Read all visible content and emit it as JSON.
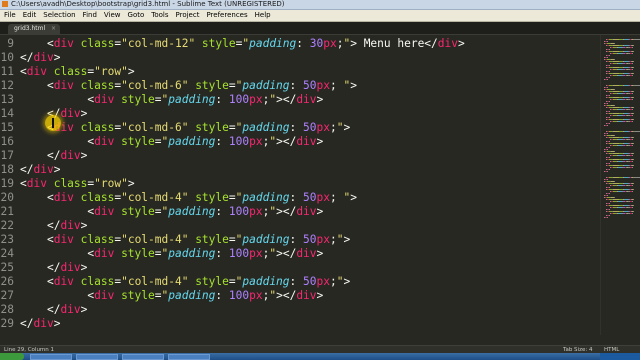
{
  "window": {
    "title": "C:\\Users\\avadh\\Desktop\\bootstrap\\grid3.html - Sublime Text (UNREGISTERED)"
  },
  "menu": [
    "File",
    "Edit",
    "Selection",
    "Find",
    "View",
    "Goto",
    "Tools",
    "Project",
    "Preferences",
    "Help"
  ],
  "tab": {
    "label": "grid3.html",
    "close_glyph": "×"
  },
  "status": {
    "position": "Line 29, Column 1",
    "tab_size": "Tab Size: 4",
    "syntax": "HTML"
  },
  "code": {
    "line_numbers": [
      "9",
      "10",
      "11",
      "12",
      "13",
      "14",
      "15",
      "16",
      "17",
      "18",
      "19",
      "20",
      "21",
      "22",
      "23",
      "24",
      "25",
      "26",
      "27",
      "28",
      "29"
    ],
    "lines": [
      [
        {
          "t": "    ",
          "c": "pn"
        },
        {
          "t": "<",
          "c": "pn"
        },
        {
          "t": "div",
          "c": "tg"
        },
        {
          "t": " class",
          "c": "at"
        },
        {
          "t": "=",
          "c": "pn"
        },
        {
          "t": "\"col-md-12\"",
          "c": "st"
        },
        {
          "t": " style",
          "c": "at"
        },
        {
          "t": "=",
          "c": "pn"
        },
        {
          "t": "\"",
          "c": "st"
        },
        {
          "t": "padding",
          "c": "cp"
        },
        {
          "t": ": ",
          "c": "pn"
        },
        {
          "t": "30",
          "c": "cv"
        },
        {
          "t": "px",
          "c": "cu"
        },
        {
          "t": ";",
          "c": "pn"
        },
        {
          "t": "\"",
          "c": "st"
        },
        {
          "t": "> Menu here</",
          "c": "pn"
        },
        {
          "t": "div",
          "c": "tg"
        },
        {
          "t": ">",
          "c": "pn"
        }
      ],
      [
        {
          "t": "</",
          "c": "pn"
        },
        {
          "t": "div",
          "c": "tg"
        },
        {
          "t": ">",
          "c": "pn"
        }
      ],
      [
        {
          "t": "<",
          "c": "pn"
        },
        {
          "t": "div",
          "c": "tg"
        },
        {
          "t": " class",
          "c": "at"
        },
        {
          "t": "=",
          "c": "pn"
        },
        {
          "t": "\"row\"",
          "c": "st"
        },
        {
          "t": ">",
          "c": "pn"
        }
      ],
      [
        {
          "t": "    ",
          "c": "pn"
        },
        {
          "t": "<",
          "c": "pn"
        },
        {
          "t": "div",
          "c": "tg"
        },
        {
          "t": " class",
          "c": "at"
        },
        {
          "t": "=",
          "c": "pn"
        },
        {
          "t": "\"col-md-6\"",
          "c": "st"
        },
        {
          "t": " style",
          "c": "at"
        },
        {
          "t": "=",
          "c": "pn"
        },
        {
          "t": "\"",
          "c": "st"
        },
        {
          "t": "padding",
          "c": "cp"
        },
        {
          "t": ": ",
          "c": "pn"
        },
        {
          "t": "50",
          "c": "cv"
        },
        {
          "t": "px",
          "c": "cu"
        },
        {
          "t": "; ",
          "c": "pn"
        },
        {
          "t": "\"",
          "c": "st"
        },
        {
          "t": ">",
          "c": "pn"
        }
      ],
      [
        {
          "t": "          ",
          "c": "pn"
        },
        {
          "t": "<",
          "c": "pn"
        },
        {
          "t": "div",
          "c": "tg"
        },
        {
          "t": " style",
          "c": "at"
        },
        {
          "t": "=",
          "c": "pn"
        },
        {
          "t": "\"",
          "c": "st"
        },
        {
          "t": "padding",
          "c": "cp"
        },
        {
          "t": ": ",
          "c": "pn"
        },
        {
          "t": "100",
          "c": "cv"
        },
        {
          "t": "px",
          "c": "cu"
        },
        {
          "t": ";",
          "c": "pn"
        },
        {
          "t": "\"",
          "c": "st"
        },
        {
          "t": "></",
          "c": "pn"
        },
        {
          "t": "div",
          "c": "tg"
        },
        {
          "t": ">",
          "c": "pn"
        }
      ],
      [
        {
          "t": "    ",
          "c": "pn"
        },
        {
          "t": "</",
          "c": "pn"
        },
        {
          "t": "div",
          "c": "tg"
        },
        {
          "t": ">",
          "c": "pn"
        }
      ],
      [
        {
          "t": "    ",
          "c": "pn"
        },
        {
          "t": "<",
          "c": "pn"
        },
        {
          "t": "div",
          "c": "tg"
        },
        {
          "t": " class",
          "c": "at"
        },
        {
          "t": "=",
          "c": "pn"
        },
        {
          "t": "\"col-md-6\"",
          "c": "st"
        },
        {
          "t": " style",
          "c": "at"
        },
        {
          "t": "=",
          "c": "pn"
        },
        {
          "t": "\"",
          "c": "st"
        },
        {
          "t": "padding",
          "c": "cp"
        },
        {
          "t": ": ",
          "c": "pn"
        },
        {
          "t": "50",
          "c": "cv"
        },
        {
          "t": "px",
          "c": "cu"
        },
        {
          "t": ";",
          "c": "pn"
        },
        {
          "t": "\"",
          "c": "st"
        },
        {
          "t": ">",
          "c": "pn"
        }
      ],
      [
        {
          "t": "          ",
          "c": "pn"
        },
        {
          "t": "<",
          "c": "pn"
        },
        {
          "t": "div",
          "c": "tg"
        },
        {
          "t": " style",
          "c": "at"
        },
        {
          "t": "=",
          "c": "pn"
        },
        {
          "t": "\"",
          "c": "st"
        },
        {
          "t": "padding",
          "c": "cp"
        },
        {
          "t": ": ",
          "c": "pn"
        },
        {
          "t": "100",
          "c": "cv"
        },
        {
          "t": "px",
          "c": "cu"
        },
        {
          "t": ";",
          "c": "pn"
        },
        {
          "t": "\"",
          "c": "st"
        },
        {
          "t": "></",
          "c": "pn"
        },
        {
          "t": "div",
          "c": "tg"
        },
        {
          "t": ">",
          "c": "pn"
        }
      ],
      [
        {
          "t": "    ",
          "c": "pn"
        },
        {
          "t": "</",
          "c": "pn"
        },
        {
          "t": "div",
          "c": "tg"
        },
        {
          "t": ">",
          "c": "pn"
        }
      ],
      [
        {
          "t": "</",
          "c": "pn"
        },
        {
          "t": "div",
          "c": "tg"
        },
        {
          "t": ">",
          "c": "pn"
        }
      ],
      [
        {
          "t": "<",
          "c": "pn"
        },
        {
          "t": "div",
          "c": "tg"
        },
        {
          "t": " class",
          "c": "at"
        },
        {
          "t": "=",
          "c": "pn"
        },
        {
          "t": "\"row\"",
          "c": "st"
        },
        {
          "t": ">",
          "c": "pn"
        }
      ],
      [
        {
          "t": "    ",
          "c": "pn"
        },
        {
          "t": "<",
          "c": "pn"
        },
        {
          "t": "div",
          "c": "tg"
        },
        {
          "t": " class",
          "c": "at"
        },
        {
          "t": "=",
          "c": "pn"
        },
        {
          "t": "\"col-md-4\"",
          "c": "st"
        },
        {
          "t": " style",
          "c": "at"
        },
        {
          "t": "=",
          "c": "pn"
        },
        {
          "t": "\"",
          "c": "st"
        },
        {
          "t": "padding",
          "c": "cp"
        },
        {
          "t": ": ",
          "c": "pn"
        },
        {
          "t": "50",
          "c": "cv"
        },
        {
          "t": "px",
          "c": "cu"
        },
        {
          "t": "; ",
          "c": "pn"
        },
        {
          "t": "\"",
          "c": "st"
        },
        {
          "t": ">",
          "c": "pn"
        }
      ],
      [
        {
          "t": "          ",
          "c": "pn"
        },
        {
          "t": "<",
          "c": "pn"
        },
        {
          "t": "div",
          "c": "tg"
        },
        {
          "t": " style",
          "c": "at"
        },
        {
          "t": "=",
          "c": "pn"
        },
        {
          "t": "\"",
          "c": "st"
        },
        {
          "t": "padding",
          "c": "cp"
        },
        {
          "t": ": ",
          "c": "pn"
        },
        {
          "t": "100",
          "c": "cv"
        },
        {
          "t": "px",
          "c": "cu"
        },
        {
          "t": ";",
          "c": "pn"
        },
        {
          "t": "\"",
          "c": "st"
        },
        {
          "t": "></",
          "c": "pn"
        },
        {
          "t": "div",
          "c": "tg"
        },
        {
          "t": ">",
          "c": "pn"
        }
      ],
      [
        {
          "t": "    ",
          "c": "pn"
        },
        {
          "t": "</",
          "c": "pn"
        },
        {
          "t": "div",
          "c": "tg"
        },
        {
          "t": ">",
          "c": "pn"
        }
      ],
      [
        {
          "t": "    ",
          "c": "pn"
        },
        {
          "t": "<",
          "c": "pn"
        },
        {
          "t": "div",
          "c": "tg"
        },
        {
          "t": " class",
          "c": "at"
        },
        {
          "t": "=",
          "c": "pn"
        },
        {
          "t": "\"col-md-4\"",
          "c": "st"
        },
        {
          "t": " style",
          "c": "at"
        },
        {
          "t": "=",
          "c": "pn"
        },
        {
          "t": "\"",
          "c": "st"
        },
        {
          "t": "padding",
          "c": "cp"
        },
        {
          "t": ": ",
          "c": "pn"
        },
        {
          "t": "50",
          "c": "cv"
        },
        {
          "t": "px",
          "c": "cu"
        },
        {
          "t": ";",
          "c": "pn"
        },
        {
          "t": "\"",
          "c": "st"
        },
        {
          "t": ">",
          "c": "pn"
        }
      ],
      [
        {
          "t": "          ",
          "c": "pn"
        },
        {
          "t": "<",
          "c": "pn"
        },
        {
          "t": "div",
          "c": "tg"
        },
        {
          "t": " style",
          "c": "at"
        },
        {
          "t": "=",
          "c": "pn"
        },
        {
          "t": "\"",
          "c": "st"
        },
        {
          "t": "padding",
          "c": "cp"
        },
        {
          "t": ": ",
          "c": "pn"
        },
        {
          "t": "100",
          "c": "cv"
        },
        {
          "t": "px",
          "c": "cu"
        },
        {
          "t": ";",
          "c": "pn"
        },
        {
          "t": "\"",
          "c": "st"
        },
        {
          "t": "></",
          "c": "pn"
        },
        {
          "t": "div",
          "c": "tg"
        },
        {
          "t": ">",
          "c": "pn"
        }
      ],
      [
        {
          "t": "    ",
          "c": "pn"
        },
        {
          "t": "</",
          "c": "pn"
        },
        {
          "t": "div",
          "c": "tg"
        },
        {
          "t": ">",
          "c": "pn"
        }
      ],
      [
        {
          "t": "    ",
          "c": "pn"
        },
        {
          "t": "<",
          "c": "pn"
        },
        {
          "t": "div",
          "c": "tg"
        },
        {
          "t": " class",
          "c": "at"
        },
        {
          "t": "=",
          "c": "pn"
        },
        {
          "t": "\"col-md-4\"",
          "c": "st"
        },
        {
          "t": " style",
          "c": "at"
        },
        {
          "t": "=",
          "c": "pn"
        },
        {
          "t": "\"",
          "c": "st"
        },
        {
          "t": "padding",
          "c": "cp"
        },
        {
          "t": ": ",
          "c": "pn"
        },
        {
          "t": "50",
          "c": "cv"
        },
        {
          "t": "px",
          "c": "cu"
        },
        {
          "t": ";",
          "c": "pn"
        },
        {
          "t": "\"",
          "c": "st"
        },
        {
          "t": ">",
          "c": "pn"
        }
      ],
      [
        {
          "t": "          ",
          "c": "pn"
        },
        {
          "t": "<",
          "c": "pn"
        },
        {
          "t": "div",
          "c": "tg"
        },
        {
          "t": " style",
          "c": "at"
        },
        {
          "t": "=",
          "c": "pn"
        },
        {
          "t": "\"",
          "c": "st"
        },
        {
          "t": "padding",
          "c": "cp"
        },
        {
          "t": ": ",
          "c": "pn"
        },
        {
          "t": "100",
          "c": "cv"
        },
        {
          "t": "px",
          "c": "cu"
        },
        {
          "t": ";",
          "c": "pn"
        },
        {
          "t": "\"",
          "c": "st"
        },
        {
          "t": "></",
          "c": "pn"
        },
        {
          "t": "div",
          "c": "tg"
        },
        {
          "t": ">",
          "c": "pn"
        }
      ],
      [
        {
          "t": "    ",
          "c": "pn"
        },
        {
          "t": "</",
          "c": "pn"
        },
        {
          "t": "div",
          "c": "tg"
        },
        {
          "t": ">",
          "c": "pn"
        }
      ],
      [
        {
          "t": "</",
          "c": "pn"
        },
        {
          "t": "div",
          "c": "tg"
        },
        {
          "t": ">",
          "c": "pn"
        }
      ]
    ]
  },
  "colors": {
    "editor_bg": "#272822",
    "tag": "#f92672",
    "attribute": "#a6e22e",
    "string": "#e6db74",
    "property": "#66d9ef",
    "number": "#ae81ff"
  }
}
